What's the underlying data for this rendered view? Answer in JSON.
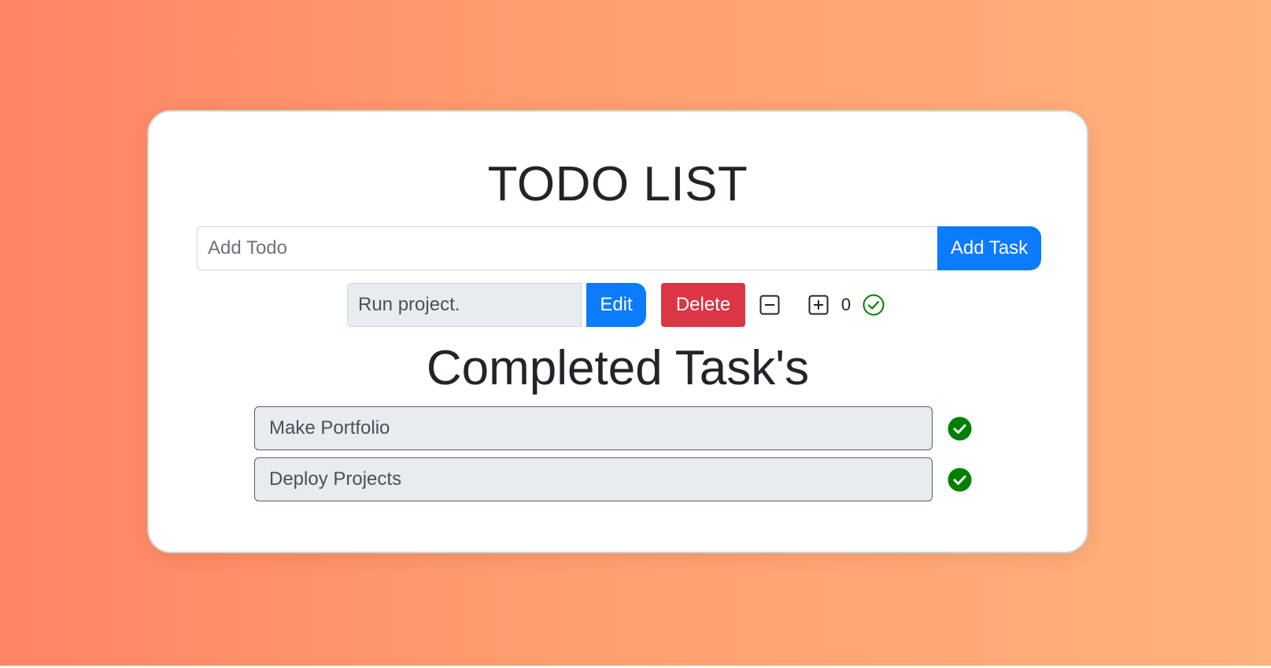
{
  "app": {
    "title": "TODO LIST",
    "accent_color": "#0b7bff",
    "danger_color": "#dc3545",
    "success_color": "#008000"
  },
  "add_form": {
    "placeholder": "Add Todo",
    "value": "",
    "button_label": "Add Task"
  },
  "active_task": {
    "text": "Run project.",
    "edit_label": "Edit",
    "delete_label": "Delete",
    "decrement_icon": "minus-square-icon",
    "increment_icon": "plus-square-icon",
    "count": "0",
    "complete_icon": "check-circle-outline-icon"
  },
  "completed": {
    "heading": "Completed Task's",
    "items": [
      {
        "text": "Make Portfolio",
        "icon": "check-circle-filled-icon"
      },
      {
        "text": "Deploy Projects",
        "icon": "check-circle-filled-icon"
      }
    ]
  }
}
